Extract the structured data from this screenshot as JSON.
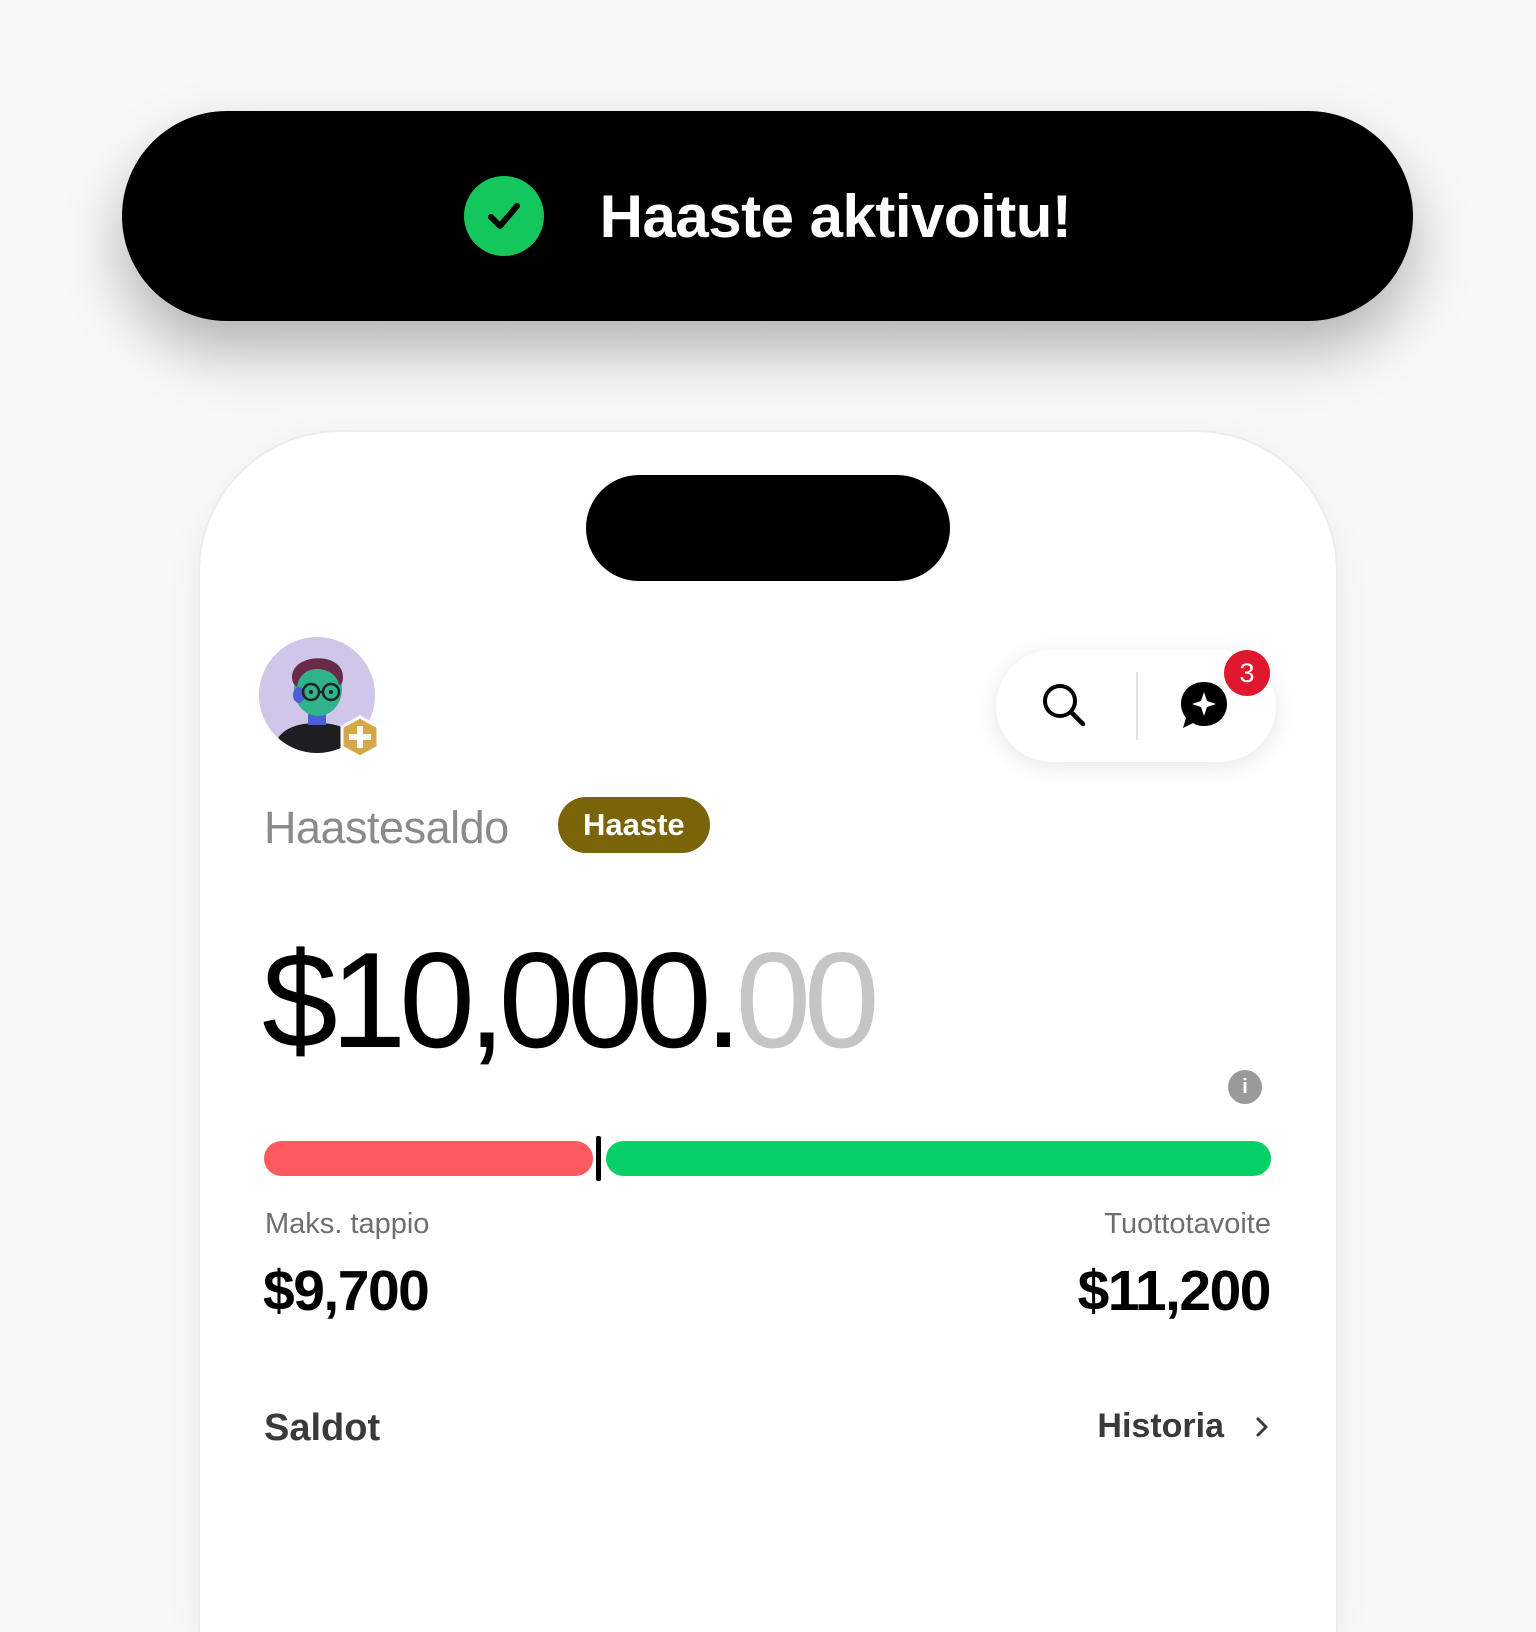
{
  "toast": {
    "message": "Haaste aktivoitu!",
    "icon": "check-circle-icon",
    "icon_color": "#13c75c"
  },
  "header": {
    "avatar_badge_icon": "plus-hexagon-icon",
    "search_icon": "search-icon",
    "chat_icon": "chat-sparkle-icon",
    "notification_count": "3",
    "notification_color": "#e0182d"
  },
  "balance": {
    "label": "Haastesaldo",
    "tag": "Haaste",
    "tag_color": "#7a6308",
    "amount_main": "$10,000.",
    "amount_cents": "00"
  },
  "progress": {
    "loss_color": "#fc5a5e",
    "profit_color": "#06cf67",
    "current_position_fraction": 0.33,
    "max_loss_label": "Maks. tappio",
    "max_loss_value": "$9,700",
    "profit_target_label": "Tuottotavoite",
    "profit_target_value": "$11,200"
  },
  "sections": {
    "balances_title": "Saldot",
    "history_link": "Historia"
  }
}
